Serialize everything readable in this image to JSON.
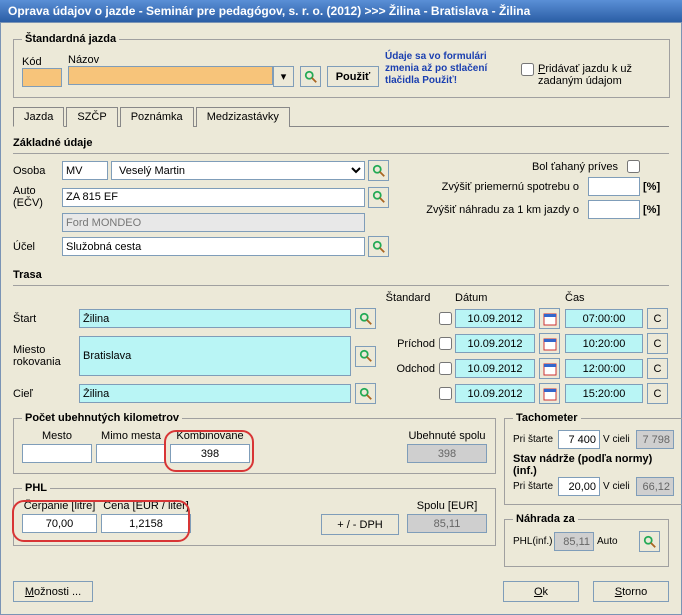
{
  "title": "Oprava údajov o jazde - Seminár pre pedagógov, s. r. o. (2012)   >>>   Žilina - Bratislava - Žilina",
  "std": {
    "legend": "Štandardná jazda",
    "kod_label": "Kód",
    "nazov_label": "Názov",
    "kod": "",
    "nazov": "",
    "pouzit": "Použiť",
    "note": "Údaje sa vo formulári zmenia až po stlačení tlačidla Použiť!",
    "pridavat_label": "Pridávať jazdu k už zadaným údajom"
  },
  "tabs": {
    "jazda": "Jazda",
    "szcp": "SZČP",
    "poznamka": "Poznámka",
    "medzi": "Medzizastávky"
  },
  "zaklad": {
    "legend": "Základné údaje",
    "osoba_lbl": "Osoba",
    "osoba_code": "MV",
    "osoba_name": "Veselý Martin",
    "auto_lbl": "Auto (EČV)",
    "ecv": "ZA 815 EF",
    "model": "Ford MONDEO",
    "ucel_lbl": "Účel",
    "ucel": "Služobná cesta",
    "prives_lbl": "Bol ťahaný príves",
    "zvysit_sp_lbl": "Zvýšiť priemernú spotrebu o",
    "zvysit_sp": "",
    "zvysit_nah_lbl": "Zvýšiť náhradu za 1 km jazdy o",
    "zvysit_nah": "",
    "pct": "[%]"
  },
  "trasa": {
    "legend": "Trasa",
    "start_lbl": "Štart",
    "start": "Žilina",
    "miesto_lbl": "Miesto rokovania",
    "miesto": "Bratislava",
    "ciel_lbl": "Cieľ",
    "ciel": "Žilina",
    "standard_hdr": "Štandard",
    "datum_hdr": "Dátum",
    "cas_hdr": "Čas",
    "prichod_lbl": "Príchod",
    "odchod_lbl": "Odchod",
    "r1_date": "10.09.2012",
    "r1_time": "07:00:00",
    "r2_date": "10.09.2012",
    "r2_time": "10:20:00",
    "r3_date": "10.09.2012",
    "r3_time": "12:00:00",
    "r4_date": "10.09.2012",
    "r4_time": "15:20:00",
    "c_btn": "C"
  },
  "km": {
    "legend": "Počet ubehnutých kilometrov",
    "mesto_lbl": "Mesto",
    "mimo_lbl": "Mimo mesta",
    "komb_lbl": "Kombinovane",
    "ubeh_lbl": "Ubehnuté spolu",
    "mesto": "",
    "mimo": "",
    "komb": "398",
    "ubeh": "398"
  },
  "phl": {
    "legend": "PHL",
    "cerp_lbl": "Čerpanie [litre]",
    "cena_lbl": "Cena [EUR / liter]",
    "spolu_lbl": "Spolu [EUR]",
    "cerp": "70,00",
    "cena": "1,2158",
    "spolu": "85,11",
    "dph_btn": "+ / -    DPH"
  },
  "tacho": {
    "legend": "Tachometer",
    "pri_starte_lbl": "Pri štarte",
    "vcieli_lbl": "V cieli",
    "pri_starte": "7 400",
    "vcieli": "7 798"
  },
  "nadrz": {
    "legend": "Stav nádrže (podľa normy) (inf.)",
    "pri_starte_lbl": "Pri štarte",
    "vcieli_lbl": "V cieli",
    "pri_starte": "20,00",
    "vcieli": "66,12"
  },
  "nahrada": {
    "legend": "Náhrada za",
    "phl_lbl": "PHL(inf.)",
    "phl": "85,11",
    "auto_lbl": "Auto"
  },
  "btns": {
    "moznosti": "Možnosti ...",
    "ok": "Ok",
    "storno": "Storno"
  }
}
